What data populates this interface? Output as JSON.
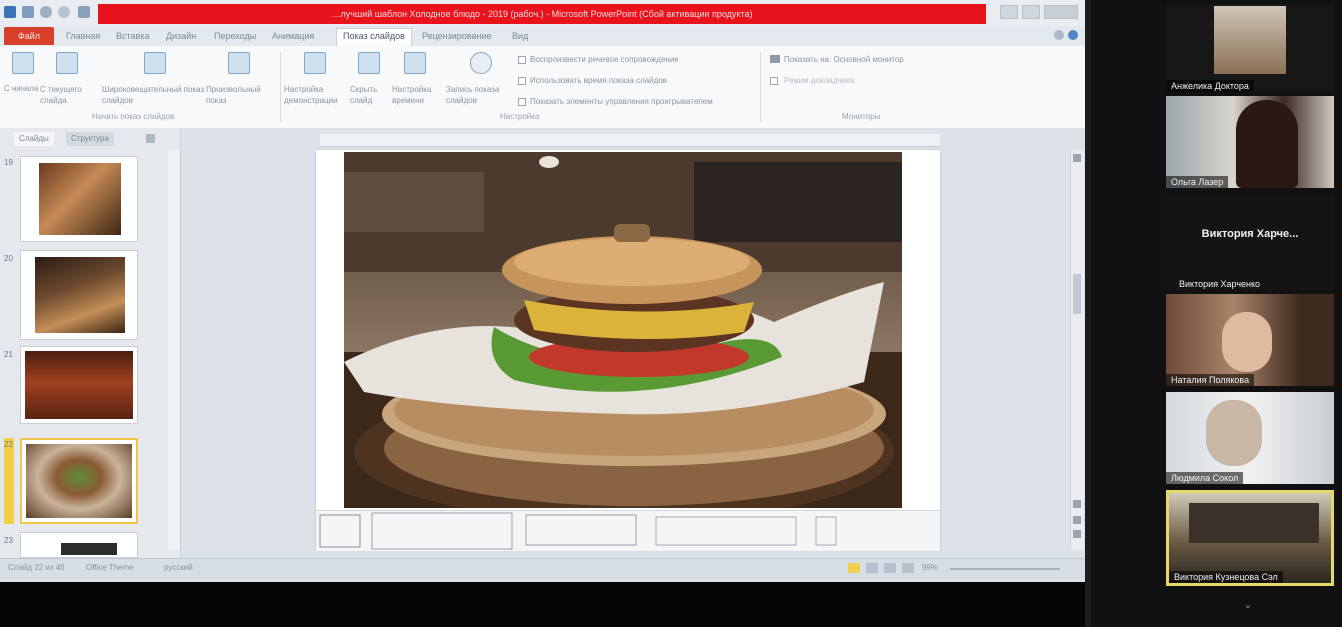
{
  "app": {
    "window_title": "…лучший шаблон Холодное блюдо - 2019 (рабоч.) - Microsoft PowerPoint (Сбой активации продукта)",
    "file_tab": "Файл",
    "tabs": [
      "Главная",
      "Вставка",
      "Дизайн",
      "Переходы",
      "Анимация",
      "Показ слайдов",
      "Рецензирование",
      "Вид"
    ],
    "active_tab": "Показ слайдов"
  },
  "ribbon": {
    "buttons": [
      {
        "label": "С начала"
      },
      {
        "label": "С текущего слайда"
      },
      {
        "label": "Широковещательный показ слайдов"
      },
      {
        "label": "Произвольный показ"
      },
      {
        "label": "Настройка демонстрации"
      },
      {
        "label": "Скрыть слайд"
      },
      {
        "label": "Настройка времени"
      },
      {
        "label": "Запись показа слайдов"
      }
    ],
    "checkboxes": [
      "Воспроизвести речевое сопровождение",
      "Использовать время показа слайдов",
      "Показать элементы управления проигрывателем"
    ],
    "monitor_items": [
      "Показать на: Основной монитор",
      "Режим докладчика"
    ],
    "groups": [
      "Начать показ слайдов",
      "Настройка",
      "Мониторы"
    ]
  },
  "slide_pane": {
    "tabs": [
      "Слайды",
      "Структура"
    ],
    "slide_numbers": [
      "19",
      "20",
      "21",
      "22",
      "23"
    ]
  },
  "statusbar": {
    "slide_info": "Слайд 22 из 46",
    "theme": "Office Theme",
    "language": "русский",
    "zoom": "99%"
  },
  "participants": [
    {
      "name": "Анжелика Доктора"
    },
    {
      "name": "Ольга Лазер"
    },
    {
      "name": "Виктория Харче..."
    },
    {
      "name": "Виктория Харченко"
    },
    {
      "name": "Наталия Полякова"
    },
    {
      "name": "Людмила Сокол"
    },
    {
      "name": "Виктория Кузнецова Сэл"
    }
  ],
  "colors": {
    "title_bar_red": "#e8131c",
    "file_tab": "#d9402b",
    "active_speaker_border": "#e7d86a"
  }
}
